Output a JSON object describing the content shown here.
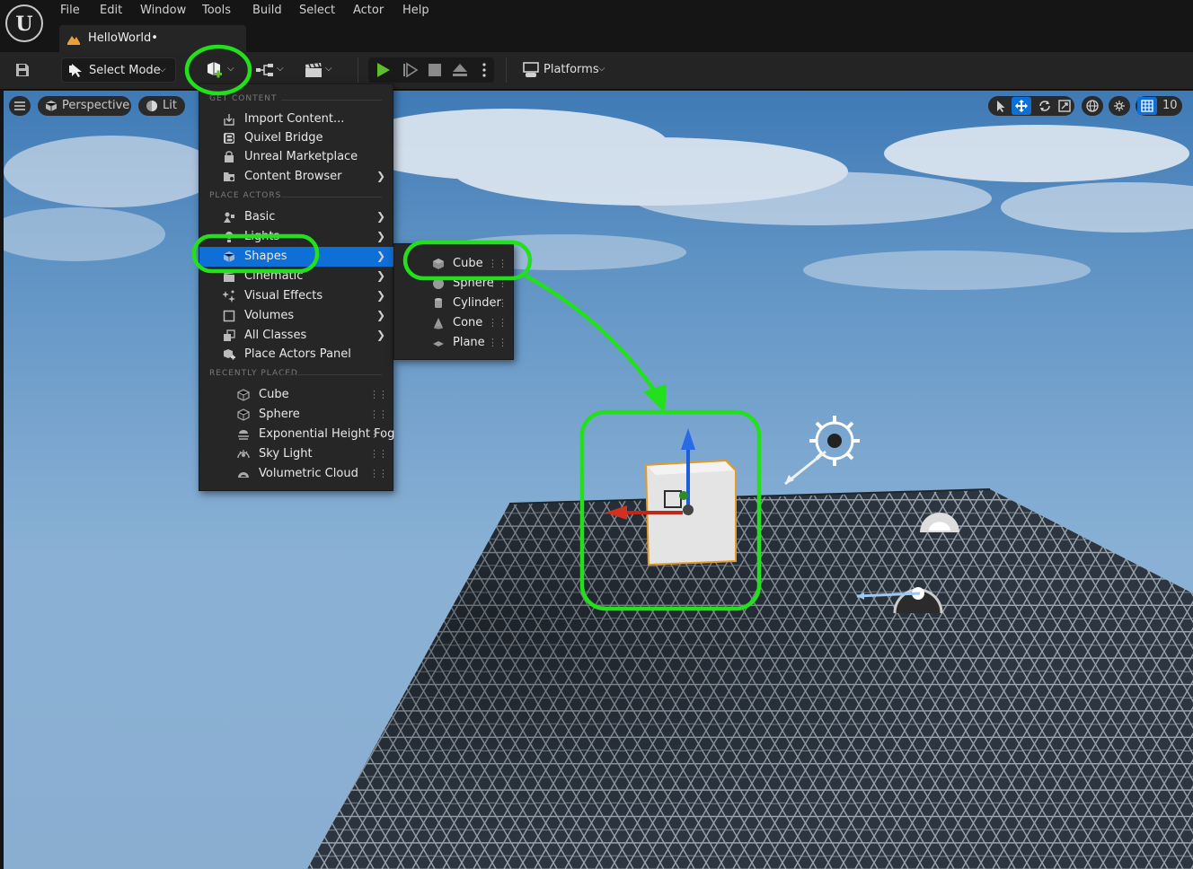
{
  "app": {
    "logo_letter": "U",
    "document_tab": "HelloWorld•"
  },
  "menu": [
    "File",
    "Edit",
    "Window",
    "Tools",
    "Build",
    "Select",
    "Actor",
    "Help"
  ],
  "toolbar": {
    "select_mode_label": "Select Mode",
    "platforms_label": "Platforms"
  },
  "viewport": {
    "perspective_label": "Perspective",
    "lit_label": "Lit",
    "grid_size": "10"
  },
  "add_menu": {
    "get_content_header": "GET CONTENT",
    "get_content_items": [
      {
        "label": "Import Content...",
        "icon": "import-icon"
      },
      {
        "label": "Quixel Bridge",
        "icon": "bridge-icon"
      },
      {
        "label": "Unreal Marketplace",
        "icon": "marketplace-icon"
      },
      {
        "label": "Content Browser",
        "icon": "content-browser-icon",
        "submenu": true
      }
    ],
    "place_actors_header": "PLACE ACTORS",
    "place_actors_items": [
      {
        "label": "Basic",
        "icon": "basic-icon",
        "submenu": true
      },
      {
        "label": "Lights",
        "icon": "light-icon",
        "submenu": true
      },
      {
        "label": "Shapes",
        "icon": "shapes-icon",
        "submenu": true,
        "highlighted": true
      },
      {
        "label": "Cinematic",
        "icon": "cinematic-icon",
        "submenu": true
      },
      {
        "label": "Visual Effects",
        "icon": "visual-effects-icon",
        "submenu": true
      },
      {
        "label": "Volumes",
        "icon": "volume-icon",
        "submenu": true
      },
      {
        "label": "All Classes",
        "icon": "all-classes-icon",
        "submenu": true
      },
      {
        "label": "Place Actors Panel",
        "icon": "place-actors-icon"
      }
    ],
    "recently_placed_header": "RECENTLY PLACED",
    "recently_placed_items": [
      {
        "label": "Cube",
        "icon": "cube-icon"
      },
      {
        "label": "Sphere",
        "icon": "sphere-icon"
      },
      {
        "label": "Exponential Height Fog",
        "icon": "fog-icon"
      },
      {
        "label": "Sky Light",
        "icon": "sky-light-icon"
      },
      {
        "label": "Volumetric Cloud",
        "icon": "cloud-icon"
      }
    ]
  },
  "shapes_menu": [
    {
      "label": "Cube",
      "icon": "cube-icon"
    },
    {
      "label": "Sphere",
      "icon": "sphere-icon"
    },
    {
      "label": "Cylinder",
      "icon": "cylinder-icon"
    },
    {
      "label": "Cone",
      "icon": "cone-icon"
    },
    {
      "label": "Plane",
      "icon": "plane-icon"
    }
  ],
  "colors": {
    "highlight": "#0e6fd6",
    "annotation": "#22e01c",
    "play_green": "#5fbf2a"
  }
}
